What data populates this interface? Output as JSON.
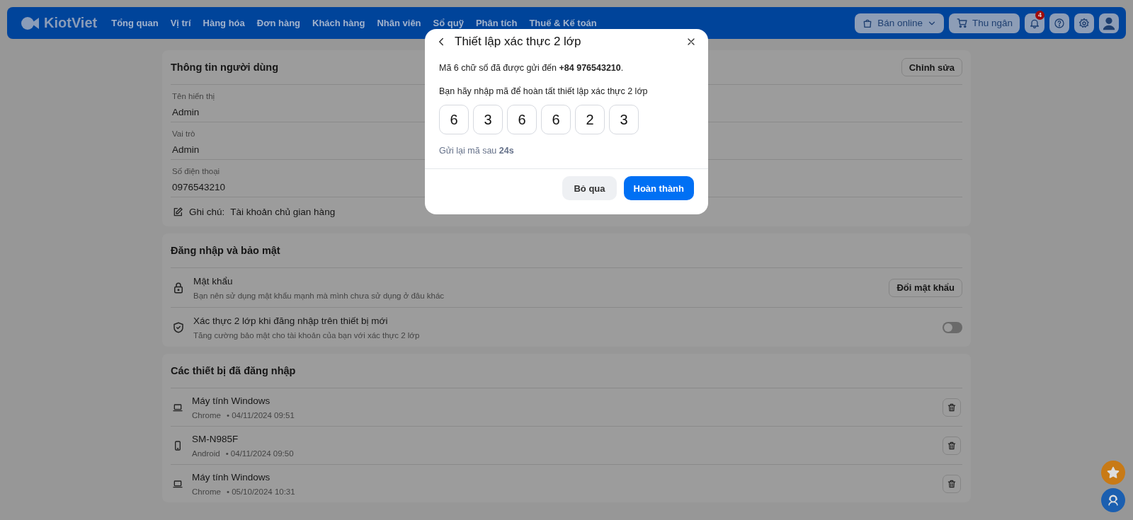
{
  "nav": {
    "logo": "KiotViet",
    "items": [
      "Tổng quan",
      "Vị trí",
      "Hàng hóa",
      "Đơn hàng",
      "Khách hàng",
      "Nhân viên",
      "Sổ quỹ",
      "Phân tích",
      "Thuế & Kế toán"
    ],
    "online_button": "Bán online",
    "cashier_button": "Thu ngân",
    "notification_count": "4"
  },
  "user_info": {
    "title": "Thông tin người dùng",
    "edit_button": "Chỉnh sửa",
    "fields": [
      {
        "label": "Tên hiển thị",
        "value": "Admin"
      },
      {
        "label": "Vai trò",
        "value": "Admin"
      },
      {
        "label": "Số điện thoại",
        "value": "0976543210"
      }
    ],
    "note": {
      "label": "Ghi chú:",
      "value": "Tài khoản chủ gian hàng"
    }
  },
  "security": {
    "title": "Đăng nhập và bảo mật",
    "items": [
      {
        "kind": "button",
        "title": "Mật khẩu",
        "description": "Bạn nên sử dụng mật khẩu mạnh mà mình chưa sử dụng ở đâu khác",
        "button": "Đổi mật khẩu"
      },
      {
        "kind": "toggle",
        "title": "Xác thực 2 lớp khi đăng nhập trên thiết bị mới",
        "description": "Tăng cường bảo mật cho tài khoản của bạn với xác thực 2 lớp",
        "on": false
      }
    ]
  },
  "devices": {
    "title": "Các thiết bị đã đăng nhập",
    "items": [
      {
        "kind": "laptop",
        "name": "Máy tính Windows",
        "app": "Chrome",
        "time": "• 04/11/2024 09:51"
      },
      {
        "kind": "phone",
        "name": "SM-N985F",
        "app": "Android",
        "time": "• 04/11/2024 09:50"
      },
      {
        "kind": "laptop",
        "name": "Máy tính Windows",
        "app": "Chrome",
        "time": "• 05/10/2024 10:31"
      }
    ]
  },
  "modal": {
    "title": "Thiết lập xác thực 2 lớp",
    "message": "Mã 6 chữ số đã được gửi đến **+84 976543210**.",
    "instruction": "Bạn hãy nhập mã để hoàn tất thiết lập xác thực 2 lớp",
    "code": [
      "6",
      "3",
      "6",
      "6",
      "2",
      "3"
    ],
    "resend": "Gửi lại mã sau **24s**",
    "buttons": [
      "Bỏ qua",
      "Hoàn thành"
    ]
  }
}
